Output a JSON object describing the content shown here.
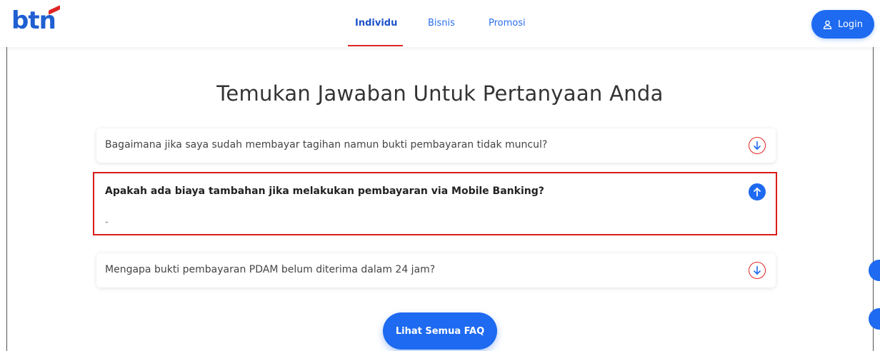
{
  "brand": {
    "logo_text": "btn",
    "primary_color": "#1e6af0",
    "accent_color": "#e02424"
  },
  "nav": {
    "items": [
      {
        "label": "Individu",
        "active": true
      },
      {
        "label": "Bisnis",
        "active": false
      },
      {
        "label": "Promosi",
        "active": false
      }
    ],
    "login_label": "Login",
    "login_icon": "user-icon"
  },
  "faq": {
    "title": "Temukan Jawaban Untuk Pertanyaan Anda",
    "items": [
      {
        "question": "Bagaimana jika saya sudah membayar tagihan namun bukti pembayaran tidak muncul?",
        "expanded": false,
        "icon": "arrow-down-icon"
      },
      {
        "question": "Apakah ada biaya tambahan jika melakukan pembayaran via Mobile Banking?",
        "answer": "-",
        "expanded": true,
        "icon": "arrow-up-icon"
      },
      {
        "question": "Mengapa bukti pembayaran PDAM belum diterima dalam 24 jam?",
        "expanded": false,
        "icon": "arrow-down-icon"
      }
    ],
    "see_all_label": "Lihat Semua FAQ"
  }
}
